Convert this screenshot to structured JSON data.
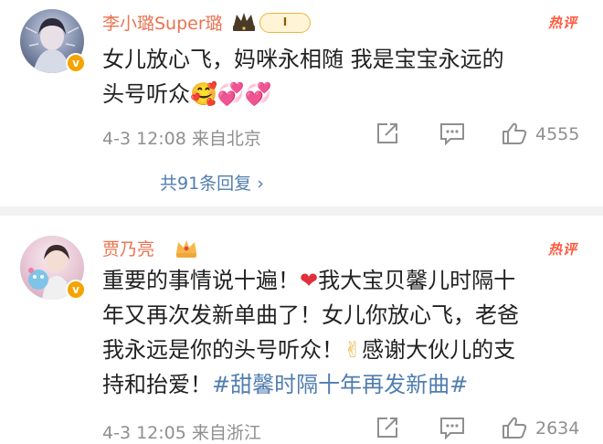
{
  "comments": [
    {
      "author": "李小璐Super璐",
      "level_badge": "I",
      "hot_tag": "热评",
      "text_lines": [
        "女儿放心飞，妈咪永相随 我是宝宝永远的",
        "头号听众"
      ],
      "emoji": "🥰💞💞",
      "meta": "4-3 12:08  来自北京",
      "likes": "4555",
      "replies": "共91条回复",
      "reply_chevron": "›",
      "verified_glyph": "v"
    },
    {
      "author": "贾乃亮",
      "hot_tag": "热评",
      "text_part1": "重要的事情说十遍！",
      "heart": "❤",
      "text_part2": "我大宝贝馨儿时隔十",
      "line2": "年又再次发新单曲了！女儿你放心飞，老爸",
      "line3a": "我永远是你的头号听众！",
      "victory": "✌",
      "line3b": "感谢大伙儿的支",
      "line4": "持和抬爱！",
      "topic": "#甜馨时隔十年再发新曲#",
      "meta": "4-3 12:05  来自浙江",
      "likes": "2634",
      "verified_glyph": "v"
    }
  ],
  "colors": {
    "name": "#eb7350",
    "link": "#507daf",
    "meta": "#8f8f8f",
    "hot": "#ff5a3d"
  }
}
